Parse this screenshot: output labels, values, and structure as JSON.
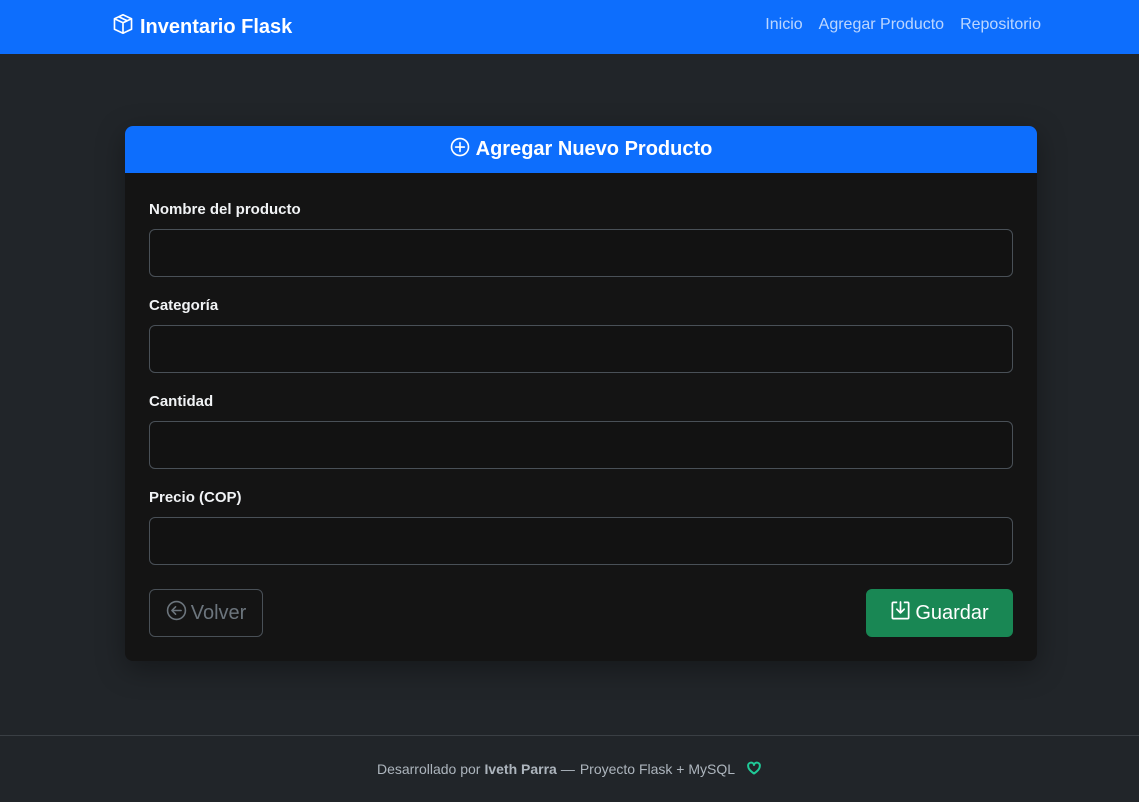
{
  "navbar": {
    "brand": "Inventario Flask",
    "brand_icon": "box-icon",
    "links": [
      "Inicio",
      "Agregar Producto",
      "Repositorio"
    ]
  },
  "card": {
    "title": "Agregar Nuevo Producto",
    "title_icon": "plus-circle-icon",
    "fields": [
      {
        "label": "Nombre del producto",
        "value": "",
        "placeholder": ""
      },
      {
        "label": "Categoría",
        "value": "",
        "placeholder": ""
      },
      {
        "label": "Cantidad",
        "value": "",
        "placeholder": ""
      },
      {
        "label": "Precio (COP)",
        "value": "",
        "placeholder": ""
      }
    ],
    "back_label": "Volver",
    "back_icon": "arrow-left-circle-icon",
    "save_label": "Guardar",
    "save_icon": "download-icon"
  },
  "footer": {
    "prefix": "Desarrollado por",
    "author": "Iveth Parra",
    "separator": "—",
    "suffix": "Proyecto Flask + MySQL",
    "icon": "heart-icon"
  },
  "colors": {
    "primary": "#0d6efd",
    "success": "#198754",
    "background": "#212529",
    "card": "#141414"
  }
}
